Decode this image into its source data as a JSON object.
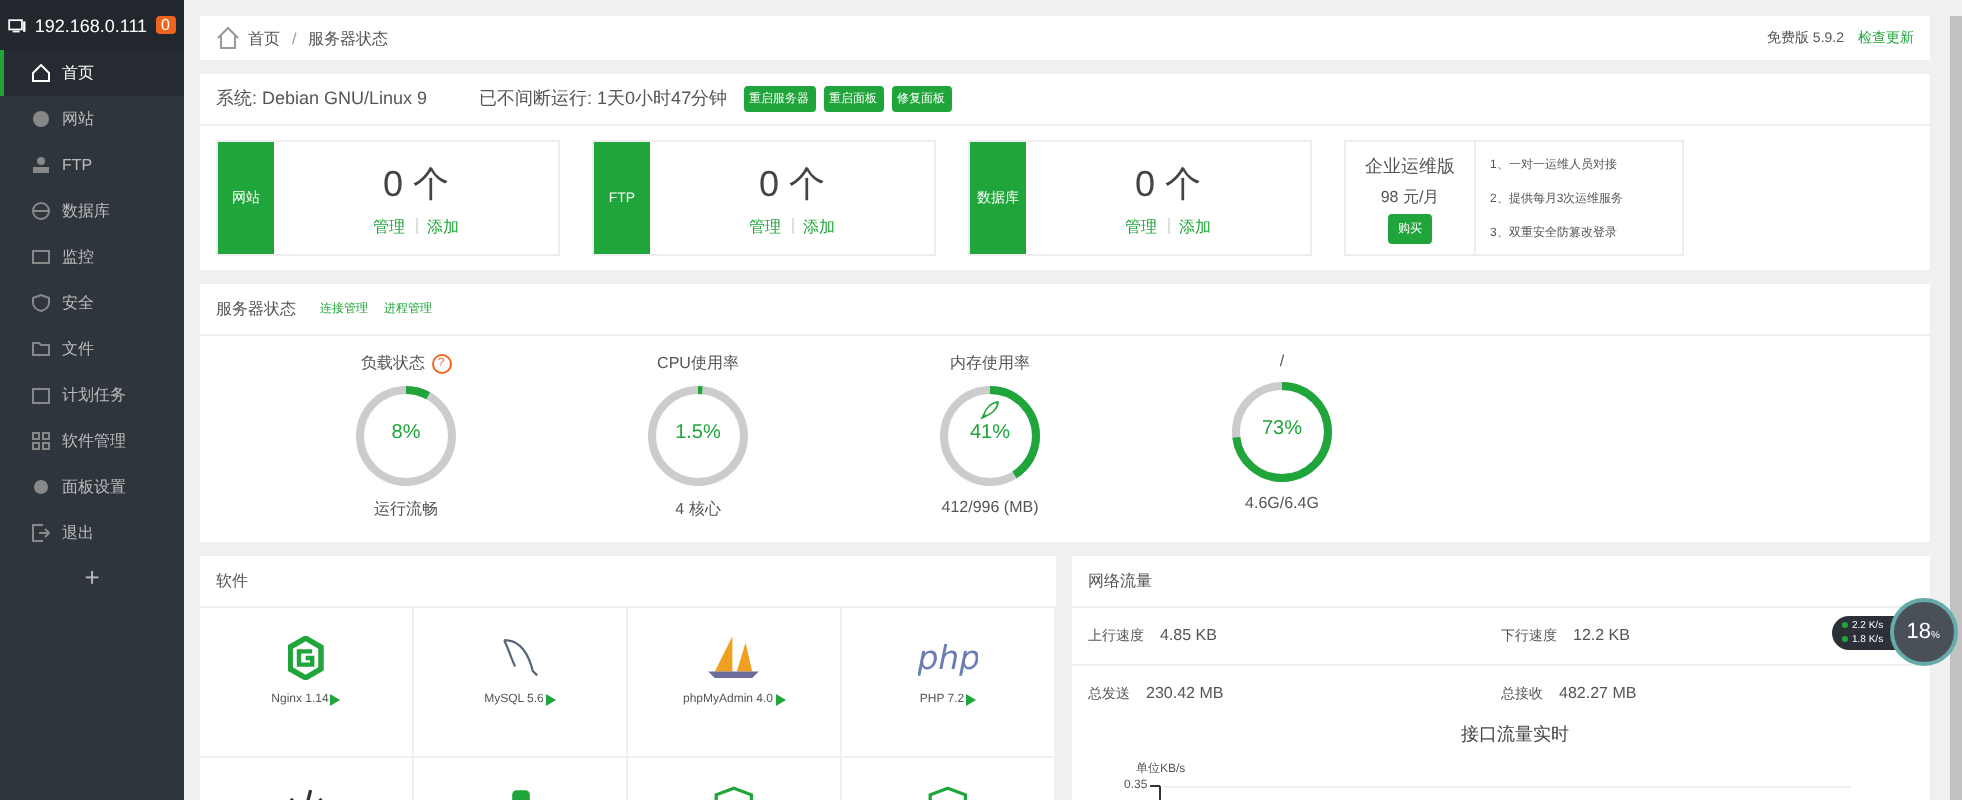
{
  "sidebar": {
    "host": "192.168.0.111",
    "badge": "0",
    "add": "+",
    "items": [
      {
        "label": "首页",
        "selected": true
      },
      {
        "label": "网站",
        "selected": false
      },
      {
        "label": "FTP",
        "selected": false
      },
      {
        "label": "数据库",
        "selected": false
      },
      {
        "label": "监控",
        "selected": false
      },
      {
        "label": "安全",
        "selected": false
      },
      {
        "label": "文件",
        "selected": false
      },
      {
        "label": "计划任务",
        "selected": false
      },
      {
        "label": "软件管理",
        "selected": false
      },
      {
        "label": "面板设置",
        "selected": false
      },
      {
        "label": "退出",
        "selected": false
      }
    ]
  },
  "breadcrumb": {
    "items": [
      "首页",
      "服务器状态"
    ],
    "separator": "/",
    "version": "免费版 5.9.2",
    "update_link": "检查更新"
  },
  "system": {
    "os": "系统: Debian GNU/Linux 9",
    "uptime": "已不间断运行: 1天0小时47分钟",
    "buttons": [
      "重启服务器",
      "重启面板",
      "修复面板"
    ]
  },
  "stats": [
    {
      "tag": "网站",
      "count": "0 个",
      "manage": "管理",
      "add": "添加"
    },
    {
      "tag": "FTP",
      "count": "0 个",
      "manage": "管理",
      "add": "添加"
    },
    {
      "tag": "数据库",
      "count": "0 个",
      "manage": "管理",
      "add": "添加"
    }
  ],
  "promo": {
    "title": "企业运维版",
    "price": "98 元/月",
    "button": "购买",
    "features": [
      "1、一对一运维人员对接",
      "2、提供每月3次运维服务",
      "3、双重安全防篡改登录"
    ]
  },
  "status": {
    "title": "服务器状态",
    "links": [
      "连接管理",
      "进程管理"
    ],
    "gauges": [
      {
        "label": "负载状态",
        "help": "?",
        "value": "8%",
        "level": 0.08,
        "caption": "运行流畅",
        "boost": false
      },
      {
        "label": "CPU使用率",
        "value": "1.5%",
        "level": 0.015,
        "caption": "4 核心",
        "boost": false
      },
      {
        "label": "内存使用率",
        "value": "41%",
        "level": 0.41,
        "caption": "412/996 (MB)",
        "boost": true
      },
      {
        "label": "/",
        "value": "73%",
        "level": 0.73,
        "caption": "4.6G/6.4G",
        "boost": false
      }
    ]
  },
  "software": {
    "title": "软件",
    "items": [
      {
        "name": "Nginx 1.14"
      },
      {
        "name": "MySQL 5.6"
      },
      {
        "name": "phpMyAdmin 4.0"
      },
      {
        "name": "PHP 7.2",
        "logo": "php"
      }
    ]
  },
  "network": {
    "title": "网络流量",
    "rows": [
      [
        {
          "label": "上行速度",
          "value": "4.85 KB"
        },
        {
          "label": "下行速度",
          "value": "12.2 KB"
        }
      ],
      [
        {
          "label": "总发送",
          "value": "230.42 MB"
        },
        {
          "label": "总接收",
          "value": "482.27 MB"
        }
      ]
    ],
    "chart_title": "接口流量实时",
    "unit": "单位KB/s",
    "ytick": "0.35"
  },
  "widget": {
    "up": "2.2 K/s",
    "down": "1.8 K/s",
    "cpu": "18",
    "percent": "%"
  }
}
